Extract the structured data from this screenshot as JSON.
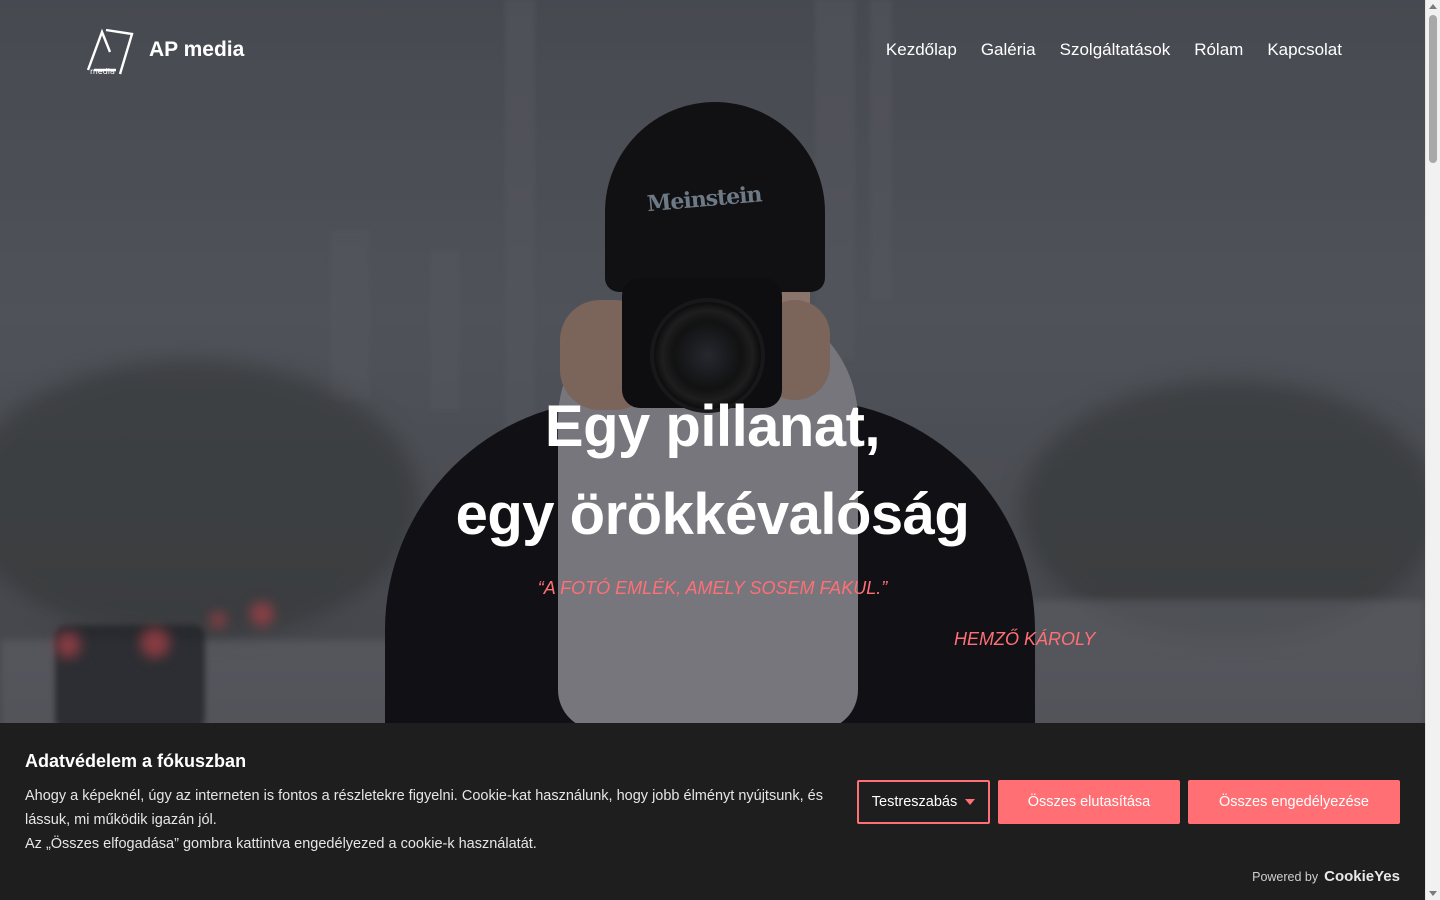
{
  "header": {
    "brand": "AP media",
    "logo_text": "media",
    "nav": [
      {
        "label": "Kezdőlap"
      },
      {
        "label": "Galéria"
      },
      {
        "label": "Szolgáltatások"
      },
      {
        "label": "Rólam"
      },
      {
        "label": "Kapcsolat"
      }
    ]
  },
  "hero": {
    "headline_line1": "Egy pillanat,",
    "headline_line2": "egy örökkévalóság",
    "quote": "“A FOTÓ EMLÉK, AMELY SOSEM FAKUL.”",
    "author": "HEMZŐ KÁROLY",
    "beanie_text": "Meinstein"
  },
  "cookie_banner": {
    "title": "Adatvédelem a fókuszban",
    "text_line1": "Ahogy a képeknél, úgy az interneten is fontos a részletekre figyelni. Cookie-kat használunk, hogy jobb élményt nyújtsunk, és lássuk, mi működik igazán jól.",
    "text_line2": "Az „Összes elfogadása” gombra kattintva engedélyezed a cookie-k használatát.",
    "customize_label": "Testreszabás",
    "reject_label": "Összes elutasítása",
    "accept_label": "Összes engedélyezése",
    "powered_by": "Powered by",
    "powered_brand": "CookieYes"
  },
  "colors": {
    "accent": "#ff6f73",
    "banner_bg": "#1e1e1e"
  }
}
